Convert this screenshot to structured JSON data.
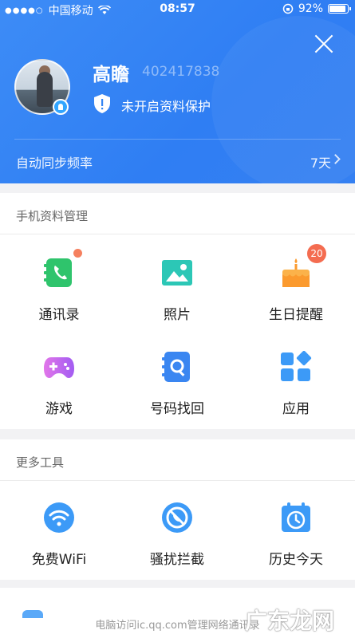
{
  "status_bar": {
    "signal_dots": "●●●●○",
    "carrier": "中国移动",
    "time": "08:57",
    "battery": "92%"
  },
  "profile": {
    "name": "高瞻",
    "qq_number": "402417838",
    "protection_status": "未开启资料保护"
  },
  "sync": {
    "label": "自动同步频率",
    "value": "7天"
  },
  "sections": {
    "phone_data": "手机资料管理",
    "more_tools": "更多工具"
  },
  "phone_data_items": [
    {
      "label": "通讯录",
      "icon": "contacts-icon"
    },
    {
      "label": "照片",
      "icon": "photo-icon"
    },
    {
      "label": "生日提醒",
      "icon": "birthday-cake-icon",
      "badge": "20"
    },
    {
      "label": "游戏",
      "icon": "gamepad-icon"
    },
    {
      "label": "号码找回",
      "icon": "number-recovery-icon"
    },
    {
      "label": "应用",
      "icon": "apps-icon"
    }
  ],
  "more_tools_items": [
    {
      "label": "免费WiFi",
      "icon": "wifi-icon"
    },
    {
      "label": "骚扰拦截",
      "icon": "block-call-icon"
    },
    {
      "label": "历史今天",
      "icon": "calendar-clock-icon"
    }
  ],
  "footer": {
    "tip": "电脑访问ic.qq.com管理网络通讯录"
  },
  "watermark": "广东龙网",
  "colors": {
    "header_blue": "#3586f4",
    "contacts_green": "#2fc46c",
    "photo_teal": "#2cc7b6",
    "birthday_orange": "#fb9a2e",
    "game_purple": "#c467f1",
    "accent_blue": "#3c9af7",
    "badge_red": "#f46c50"
  }
}
